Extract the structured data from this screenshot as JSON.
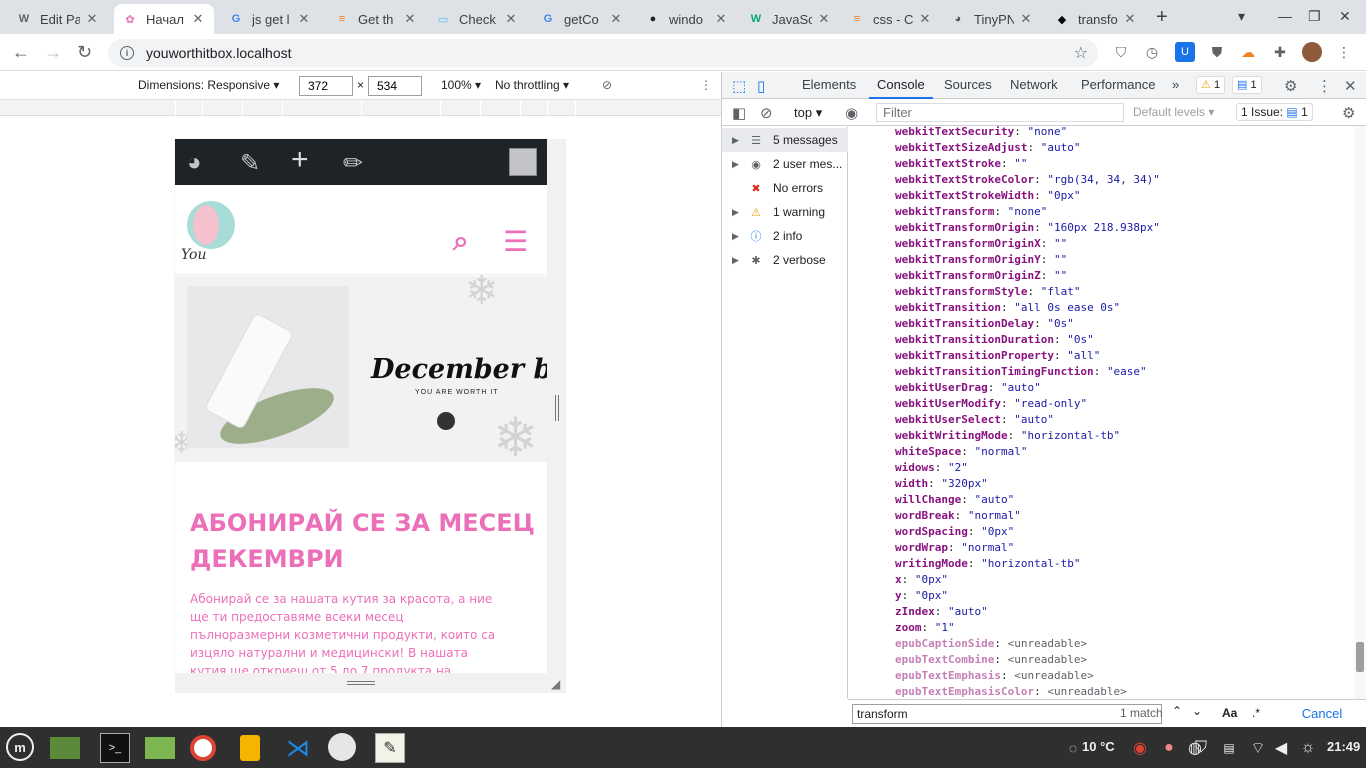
{
  "tabs": [
    {
      "title": "Edit Pa",
      "icon": "wordpress-icon"
    },
    {
      "title": "Начал",
      "icon": "site-icon"
    },
    {
      "title": "js get l",
      "icon": "google-icon"
    },
    {
      "title": "Get th",
      "icon": "stack-overflow-icon"
    },
    {
      "title": "Check",
      "icon": "chat-icon"
    },
    {
      "title": "getCo",
      "icon": "google-icon"
    },
    {
      "title": "windo",
      "icon": "github-icon"
    },
    {
      "title": "JavaSc",
      "icon": "w3schools-icon"
    },
    {
      "title": "css - Cl",
      "icon": "stack-overflow-icon"
    },
    {
      "title": "TinyPN",
      "icon": "panda-icon"
    },
    {
      "title": "transfo",
      "icon": "codepen-icon"
    }
  ],
  "address": {
    "url": "youworthitbox.localhost"
  },
  "device_toolbar": {
    "dimensions_label": "Dimensions: Responsive",
    "width": "372",
    "times": "×",
    "height": "534",
    "zoom": "100%",
    "throttling": "No throttling"
  },
  "site": {
    "logo_text": "You",
    "banner_title": "December box",
    "banner_sub": "YOU ARE WORTH IT",
    "heading": "АБОНИРАЙ СЕ ЗА МЕСЕЦ ДЕКЕМВРИ",
    "body": "Абонирай се за нашата кутия за красота, а ние ще ти предоставяме всеки месец пълноразмерни козметични продукти, които са изцяло натурални и медицински! В нашата кутия ще откриеш от 5 до 7 продукта на",
    "accent_color": "#ec6fb9"
  },
  "devtools": {
    "tabs": [
      "Elements",
      "Console",
      "Sources",
      "Network",
      "Performance"
    ],
    "active_tab": "Console",
    "more": "»",
    "warning_count": "1",
    "message_count": "1",
    "context": "top",
    "filter_placeholder": "Filter",
    "levels": "Default levels",
    "issues_label": "1 Issue:",
    "issues_count": "1",
    "sidebar": [
      {
        "label": "5 messages",
        "icon": "list-icon"
      },
      {
        "label": "2 user mes...",
        "icon": "user-icon"
      },
      {
        "label": "No errors",
        "icon": "error-icon"
      },
      {
        "label": "1 warning",
        "icon": "warning-icon"
      },
      {
        "label": "2 info",
        "icon": "info-icon"
      },
      {
        "label": "2 verbose",
        "icon": "bug-icon"
      }
    ],
    "properties": [
      {
        "k": "webkitTextSecurity",
        "v": "\"none\""
      },
      {
        "k": "webkitTextSizeAdjust",
        "v": "\"auto\""
      },
      {
        "k": "webkitTextStroke",
        "v": "\"\""
      },
      {
        "k": "webkitTextStrokeColor",
        "v": "\"rgb(34, 34, 34)\""
      },
      {
        "k": "webkitTextStrokeWidth",
        "v": "\"0px\""
      },
      {
        "k": "webkitTransform",
        "v": "\"none\""
      },
      {
        "k": "webkitTransformOrigin",
        "v": "\"160px 218.938px\""
      },
      {
        "k": "webkitTransformOriginX",
        "v": "\"\""
      },
      {
        "k": "webkitTransformOriginY",
        "v": "\"\""
      },
      {
        "k": "webkitTransformOriginZ",
        "v": "\"\""
      },
      {
        "k": "webkitTransformStyle",
        "v": "\"flat\""
      },
      {
        "k": "webkitTransition",
        "v": "\"all 0s ease 0s\""
      },
      {
        "k": "webkitTransitionDelay",
        "v": "\"0s\""
      },
      {
        "k": "webkitTransitionDuration",
        "v": "\"0s\""
      },
      {
        "k": "webkitTransitionProperty",
        "v": "\"all\""
      },
      {
        "k": "webkitTransitionTimingFunction",
        "v": "\"ease\""
      },
      {
        "k": "webkitUserDrag",
        "v": "\"auto\""
      },
      {
        "k": "webkitUserModify",
        "v": "\"read-only\""
      },
      {
        "k": "webkitUserSelect",
        "v": "\"auto\""
      },
      {
        "k": "webkitWritingMode",
        "v": "\"horizontal-tb\""
      },
      {
        "k": "whiteSpace",
        "v": "\"normal\""
      },
      {
        "k": "widows",
        "v": "\"2\""
      },
      {
        "k": "width",
        "v": "\"320px\""
      },
      {
        "k": "willChange",
        "v": "\"auto\""
      },
      {
        "k": "wordBreak",
        "v": "\"normal\""
      },
      {
        "k": "wordSpacing",
        "v": "\"0px\""
      },
      {
        "k": "wordWrap",
        "v": "\"normal\""
      },
      {
        "k": "writingMode",
        "v": "\"horizontal-tb\""
      },
      {
        "k": "x",
        "v": "\"0px\""
      },
      {
        "k": "y",
        "v": "\"0px\""
      },
      {
        "k": "zIndex",
        "v": "\"auto\""
      },
      {
        "k": "zoom",
        "v": "\"1\""
      },
      {
        "k": "epubCaptionSide",
        "v": "<unreadable>",
        "dim": true
      },
      {
        "k": "epubTextCombine",
        "v": "<unreadable>",
        "dim": true
      },
      {
        "k": "epubTextEmphasis",
        "v": "<unreadable>",
        "dim": true
      },
      {
        "k": "epubTextEmphasisColor",
        "v": "<unreadable>",
        "dim": true
      }
    ],
    "search": {
      "query": "transform",
      "match": "1 match",
      "case": "Aa",
      "regex": ".*",
      "cancel": "Cancel"
    }
  },
  "taskbar": {
    "temperature": "10 °C",
    "time": "21:49"
  }
}
